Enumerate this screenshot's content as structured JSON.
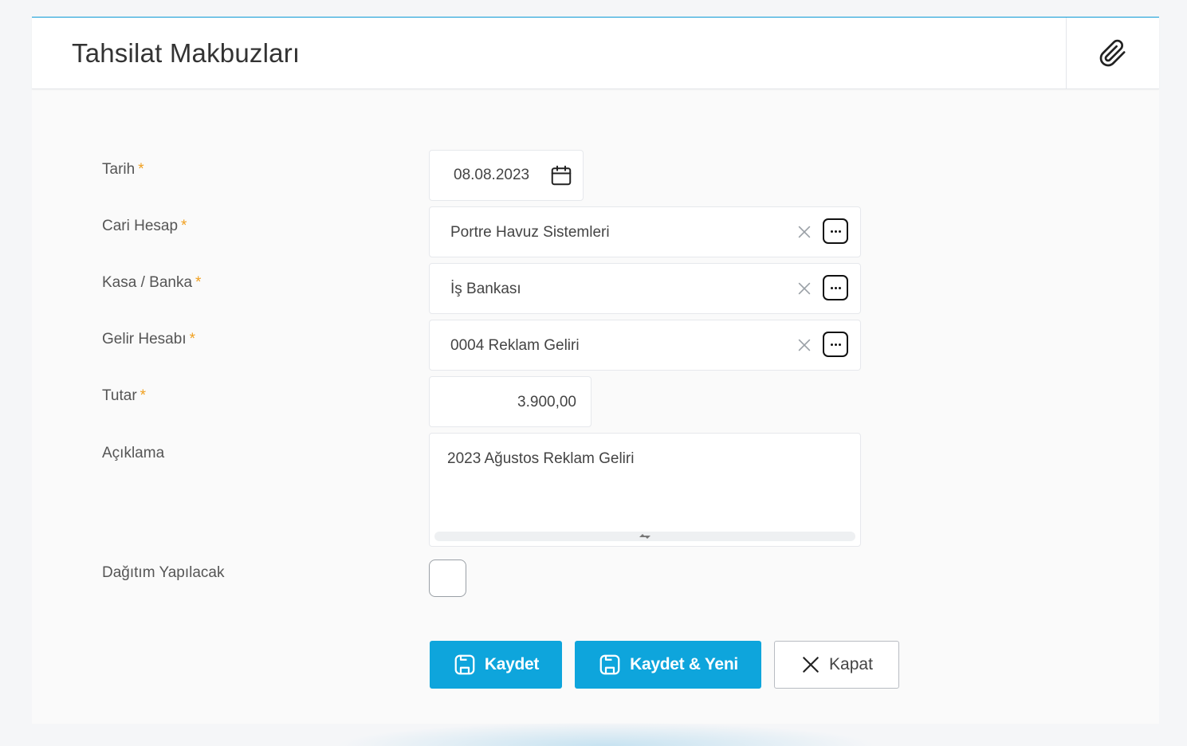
{
  "header": {
    "title": "Tahsilat Makbuzları",
    "attach_icon": "paperclip-icon"
  },
  "form": {
    "required_mark": "*",
    "tarih": {
      "label": "Tarih",
      "value": "08.08.2023",
      "icon": "calendar-icon"
    },
    "cari_hesap": {
      "label": "Cari Hesap",
      "value": "Portre Havuz Sistemleri"
    },
    "kasa_banka": {
      "label": "Kasa / Banka",
      "value": "İş Bankası"
    },
    "gelir_hesabi": {
      "label": "Gelir Hesabı",
      "value": "0004 Reklam Geliri"
    },
    "tutar": {
      "label": "Tutar",
      "value": "3.900,00"
    },
    "aciklama": {
      "label": "Açıklama",
      "value": "2023 Ağustos Reklam Geliri"
    },
    "dagitim": {
      "label": "Dağıtım Yapılacak",
      "checked": false
    }
  },
  "actions": {
    "save_label": "Kaydet",
    "save_new_label": "Kaydet & Yeni",
    "close_label": "Kapat"
  },
  "colors": {
    "primary": "#0ea5dc",
    "required": "#f0a020",
    "header_border": "#0d9bd6"
  }
}
